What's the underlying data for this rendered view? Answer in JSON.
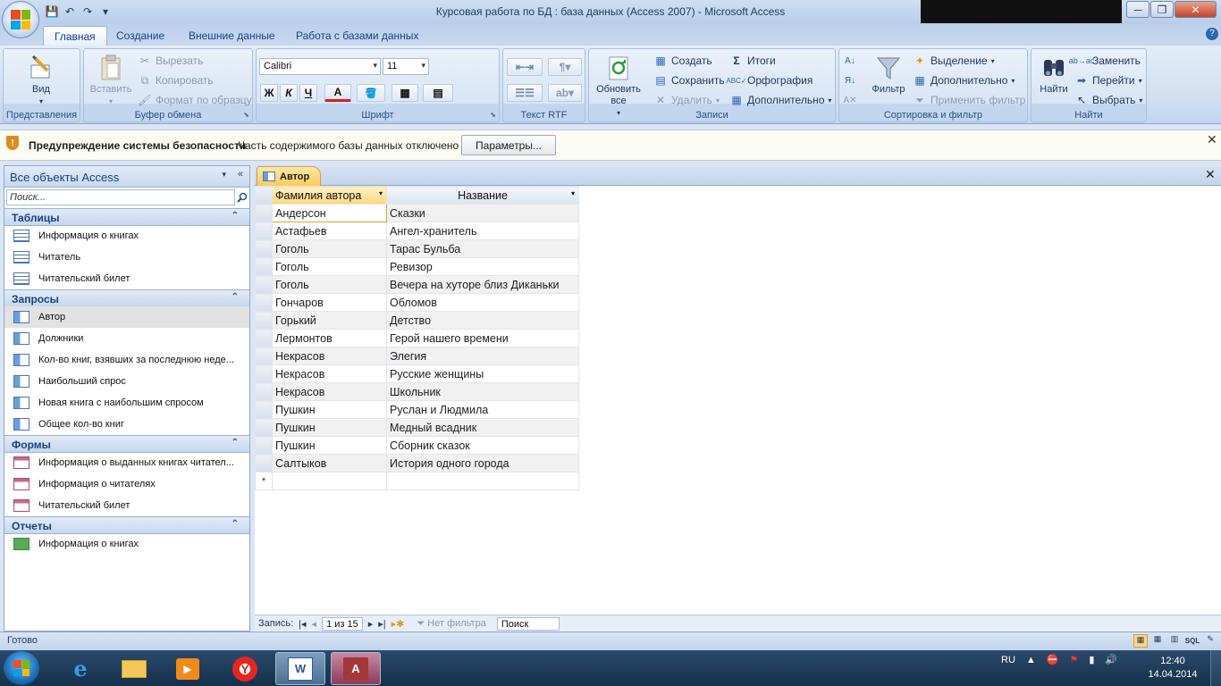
{
  "window": {
    "title": "Курсовая работа по БД : база данных (Access 2007)  -  Microsoft Access"
  },
  "ribbon_tabs": [
    "Главная",
    "Создание",
    "Внешние данные",
    "Работа с базами данных"
  ],
  "ribbon": {
    "views": {
      "view_label": "Вид",
      "group_label": "Представления"
    },
    "clipboard": {
      "paste_label": "Вставить",
      "cut_label": "Вырезать",
      "copy_label": "Копировать",
      "format_painter_label": "Формат по образцу",
      "group_label": "Буфер обмена"
    },
    "font": {
      "font_name": "Calibri",
      "font_size": "11",
      "bold": "Ж",
      "italic": "К",
      "underline": "Ч",
      "font_color": "А",
      "group_label": "Шрифт"
    },
    "rtf": {
      "group_label": "Текст RTF"
    },
    "records": {
      "refresh_label": "Обновить все",
      "new_label": "Создать",
      "save_label": "Сохранить",
      "delete_label": "Удалить",
      "totals_label": "Итоги",
      "spelling_label": "Орфография",
      "more_label": "Дополнительно",
      "group_label": "Записи"
    },
    "sort_filter": {
      "filter_label": "Фильтр",
      "selection_label": "Выделение",
      "advanced_label": "Дополнительно",
      "apply_filter_label": "Применить фильтр",
      "group_label": "Сортировка и фильтр"
    },
    "find": {
      "find_label": "Найти",
      "replace_label": "Заменить",
      "goto_label": "Перейти",
      "select_label": "Выбрать",
      "group_label": "Найти"
    }
  },
  "security_bar": {
    "title": "Предупреждение системы безопасности",
    "message": "Часть содержимого базы данных отключено",
    "button_label": "Параметры..."
  },
  "nav_pane": {
    "header": "Все объекты Access",
    "search_placeholder": "Поиск...",
    "categories": [
      {
        "name": "Таблицы",
        "items": [
          "Информация о книгах",
          "Читатель",
          "Читательский билет"
        ]
      },
      {
        "name": "Запросы",
        "items": [
          "Автор",
          "Должники",
          "Кол-во книг, взявших за последнюю неде...",
          "Наибольший спрос",
          "Новая книга с наибольшим спросом",
          "Общее кол-во книг"
        ]
      },
      {
        "name": "Формы",
        "items": [
          "Информация о выданных книгах читател...",
          "Информация о читателях",
          "Читательский билет"
        ]
      },
      {
        "name": "Отчеты",
        "items": [
          "Информация о книгах"
        ]
      }
    ]
  },
  "document": {
    "tab_label": "Автор",
    "columns": [
      "Фамилия автора",
      "Название"
    ],
    "rows": [
      [
        "Андерсон",
        "Сказки"
      ],
      [
        "Астафьев",
        "Ангел-хранитель"
      ],
      [
        "Гоголь",
        "Тарас Бульба"
      ],
      [
        "Гоголь",
        "Ревизор"
      ],
      [
        "Гоголь",
        " Вечера на хуторе близ Диканьки"
      ],
      [
        "Гончаров",
        "Обломов"
      ],
      [
        "Горький",
        "Детство"
      ],
      [
        "Лермонтов",
        "Герой нашего времени"
      ],
      [
        "Некрасов",
        "Элегия"
      ],
      [
        "Некрасов",
        "Русские женщины"
      ],
      [
        "Некрасов",
        "Школьник"
      ],
      [
        "Пушкин",
        "Руслан и Людмила"
      ],
      [
        "Пушкин",
        "Медный всадник"
      ],
      [
        "Пушкин",
        "Сборник сказок"
      ],
      [
        "Салтыков",
        "История одного города"
      ]
    ],
    "new_row_marker": "*",
    "record_nav": {
      "label": "Запись:",
      "position": "1 из 15",
      "filter_label": "Нет фильтра",
      "search_label": "Поиск"
    }
  },
  "status_bar": {
    "text": "Готово"
  },
  "taskbar": {
    "language": "RU",
    "time": "12:40",
    "date": "14.04.2014"
  }
}
